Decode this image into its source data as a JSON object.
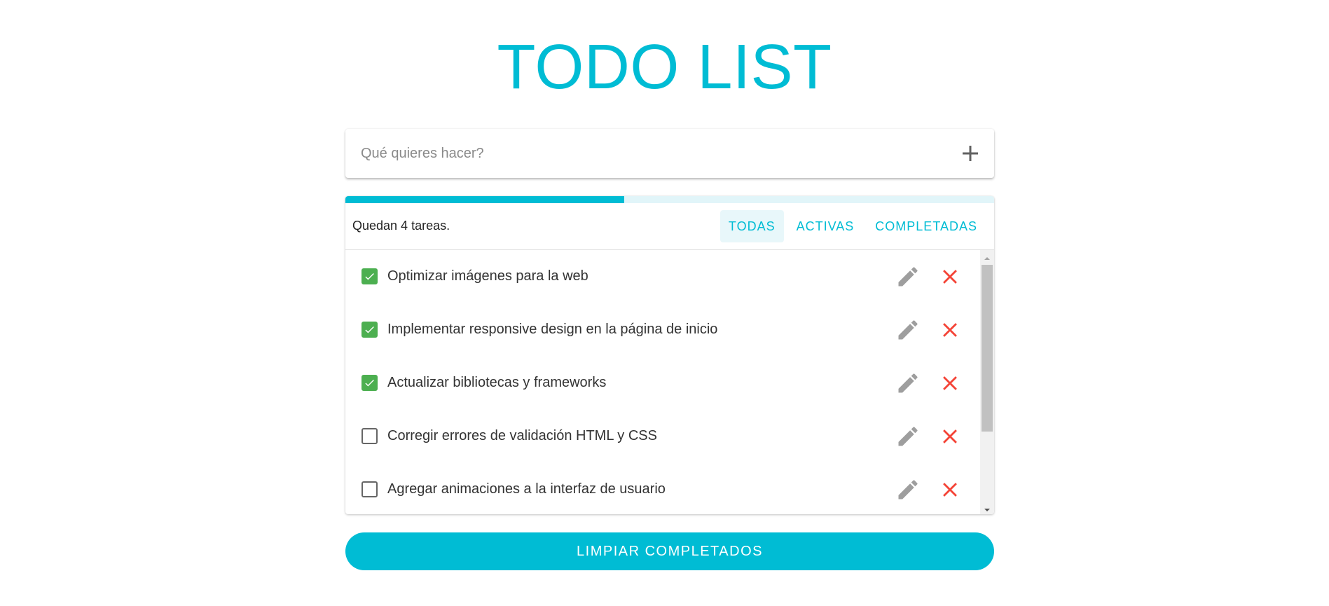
{
  "header": {
    "title": "TODO LIST"
  },
  "new_todo": {
    "placeholder": "Qué quieres hacer?",
    "add_icon": "plus-icon"
  },
  "status": {
    "remaining_text": "Quedan 4 tareas.",
    "progress": 0.43
  },
  "filters": [
    {
      "label": "TODAS",
      "active": true
    },
    {
      "label": "ACTIVAS",
      "active": false
    },
    {
      "label": "COMPLETADAS",
      "active": false
    }
  ],
  "todos": [
    {
      "text": "Optimizar imágenes para la web",
      "completed": true
    },
    {
      "text": "Implementar responsive design en la página de inicio",
      "completed": true
    },
    {
      "text": "Actualizar bibliotecas y frameworks",
      "completed": true
    },
    {
      "text": "Corregir errores de validación HTML y CSS",
      "completed": false
    },
    {
      "text": "Agregar animaciones a la interfaz de usuario",
      "completed": false
    }
  ],
  "actions": {
    "clear_completed_label": "LIMPIAR COMPLETADOS",
    "edit_icon": "pencil-icon",
    "delete_icon": "close-icon"
  },
  "colors": {
    "accent": "#00bcd4",
    "checked": "#4caf50",
    "delete": "#f44336",
    "icon_gray": "#9e9e9e"
  }
}
